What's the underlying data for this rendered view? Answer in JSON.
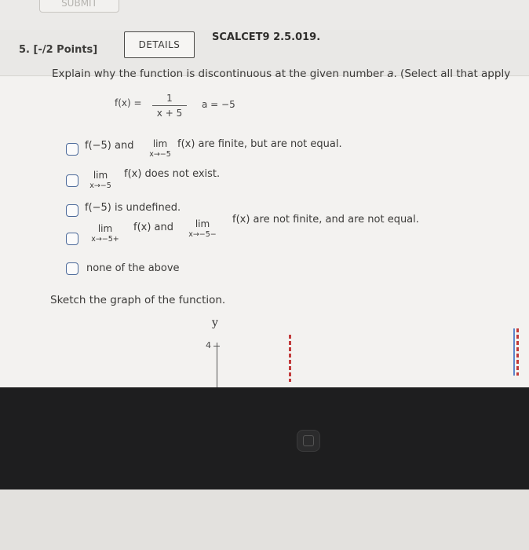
{
  "submit_label": "SUBMIT",
  "question": {
    "points": "5. [-/2 Points]",
    "details_label": "DETAILS",
    "id": "SCALCET9 2.5.019.",
    "prompt": "Explain why the function is discontinuous at the given number",
    "prompt_var": "a",
    "prompt_tail": ". (Select all that apply",
    "fn_label": "f(x)  =",
    "fn_num": "1",
    "fn_den": "x + 5",
    "a_value": "a = −5"
  },
  "options": [
    {
      "pre": "f(−5) and",
      "lim": "lim",
      "sub": "x→−5",
      "post": "f(x) are finite, but are not equal."
    },
    {
      "lim": "lim",
      "sub": "x→−5",
      "post": "f(x) does not exist."
    },
    {
      "text": "f(−5) is undefined."
    },
    {
      "lim1": "lim",
      "sub1": "x→−5+",
      "mid": "f(x) and",
      "lim2": "lim",
      "sub2": "x→−5−",
      "post": "f(x) are not finite, and are not equal."
    },
    {
      "text": "none of the above"
    }
  ],
  "sketch": {
    "prompt": "Sketch the graph of the function.",
    "y_label": "y",
    "tick_4": "4"
  },
  "colors": {
    "checkbox_border": "#4c6a9a",
    "asymptote_red": "#c23b3b",
    "asymptote_blue": "#5b84cc"
  }
}
